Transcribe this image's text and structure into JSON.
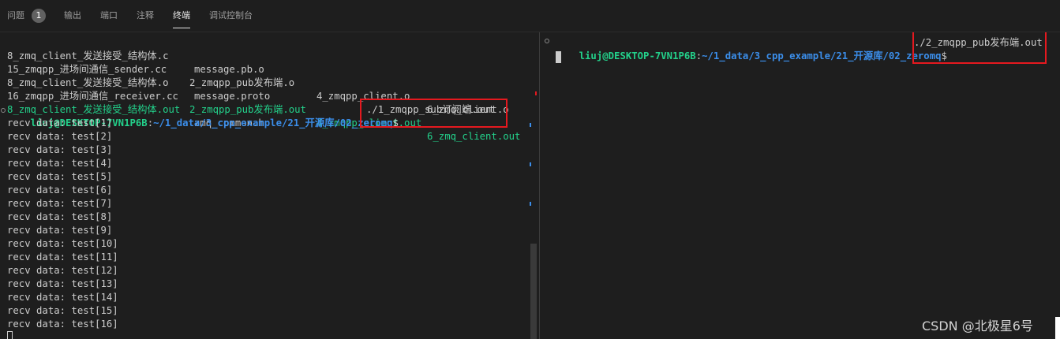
{
  "tabs": [
    {
      "label": "问题"
    },
    {
      "label": "输出"
    },
    {
      "label": "端口"
    },
    {
      "label": "注释"
    },
    {
      "label": "终端"
    },
    {
      "label": "调试控制台"
    }
  ],
  "problems_count": "1",
  "left_terminal": {
    "ls": [
      [
        "8_zmq_client_发送接受_结构体.c",
        "message.pb.o"
      ],
      [
        "15_zmqpp_进场间通信_sender.cc",
        "2_zmqpp_pub发布端.o",
        "4_zmqpp_client.o",
        "6_zmq_client.o"
      ],
      [
        "8_zmq_client_发送接受_结构体.o",
        "message.proto"
      ],
      [
        "16_zmqpp_进场间通信_receiver.cc",
        "2_zmqpp_pub发布端.out",
        "4_zmqpp_client.out",
        "6_zmq_client.out"
      ],
      [
        "8_zmq_client_发送接受_结构体.out",
        "zmq_common.h"
      ]
    ],
    "prompt_user": "liuj@DESKTOP-7VN1P6B",
    "prompt_path": "~/1_data/3_cpp_example/21_开源库/02_zeromq",
    "prompt_symbol": "$",
    "command": "./1_zmqpp_sub订阅端.out",
    "output": [
      "recv data: test[1]",
      "recv data: test[2]",
      "recv data: test[3]",
      "recv data: test[4]",
      "recv data: test[5]",
      "recv data: test[6]",
      "recv data: test[7]",
      "recv data: test[8]",
      "recv data: test[9]",
      "recv data: test[10]",
      "recv data: test[11]",
      "recv data: test[12]",
      "recv data: test[13]",
      "recv data: test[14]",
      "recv data: test[15]",
      "recv data: test[16]"
    ]
  },
  "right_terminal": {
    "prompt_user": "liuj@DESKTOP-7VN1P6B",
    "prompt_path": "~/1_data/3_cpp_example/21_开源库/02_zeromq",
    "prompt_symbol": "$",
    "command": "./2_zmqpp_pub发布端.out"
  },
  "colors": {
    "background": "#1e1e1e",
    "executable": "#23d18b",
    "prompt_path": "#3b8eea",
    "highlight_box": "#e5191f"
  },
  "watermark": "CSDN @北极星6号"
}
